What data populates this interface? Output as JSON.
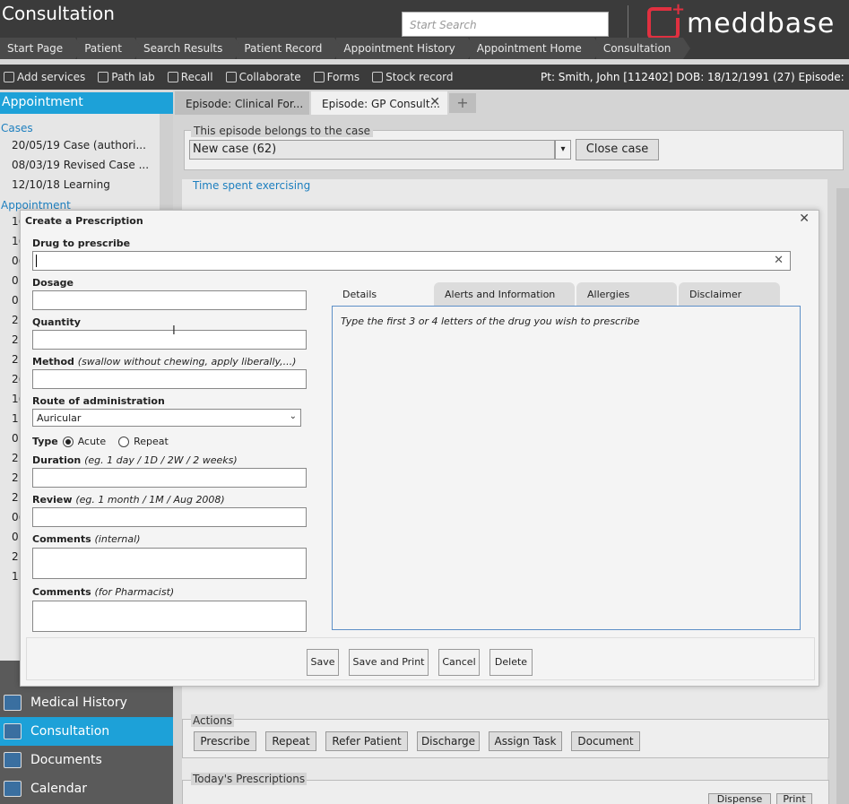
{
  "header": {
    "app_title": "Consultation",
    "search_placeholder": "Start Search",
    "logo_text": "meddbase"
  },
  "breadcrumbs": [
    "Start Page",
    "Patient",
    "Search Results",
    "Patient Record",
    "Appointment History",
    "Appointment Home",
    "Consultation"
  ],
  "toolbar": {
    "items": [
      "Add services",
      "Path lab",
      "Recall",
      "Collaborate",
      "Forms",
      "Stock record"
    ],
    "patient_info": "Pt: Smith, John [112402] DOB: 18/12/1991 (27) Episode:"
  },
  "sidebar": {
    "section_title": "Appointment",
    "cases_label": "Cases",
    "cases": [
      "20/05/19 Case (authori...",
      "08/03/19 Revised Case ...",
      "12/10/18 Learning"
    ],
    "appointments_label": "Appointment",
    "appointments": [
      "1(",
      "1(",
      "0(",
      "0:",
      "0:",
      "2:",
      "2:",
      "2:",
      "2(",
      "1(",
      "1:",
      "0:",
      "2:",
      "2:",
      "2:",
      "0(",
      "0:",
      "2:",
      "1:"
    ],
    "nav": [
      "Medical History",
      "Consultation",
      "Documents",
      "Calendar"
    ]
  },
  "tabs": [
    {
      "label": "Episode: Clinical For..."
    },
    {
      "label": "Episode: GP Consult..."
    }
  ],
  "case": {
    "legend": "This episode belongs to the case",
    "selected": "New case (62)",
    "close_label": "Close case",
    "exercising_label": "Time spent exercising"
  },
  "actions": {
    "legend": "Actions",
    "buttons": [
      "Prescribe",
      "Repeat",
      "Refer Patient",
      "Discharge",
      "Assign Task",
      "Document"
    ]
  },
  "prescriptions": {
    "legend": "Today's Prescriptions",
    "buttons": [
      "Dispense",
      "Print"
    ]
  },
  "modal": {
    "title": "Create a Prescription",
    "drug_label": "Drug to prescribe",
    "drug_value": "",
    "dosage_label": "Dosage",
    "quantity_label": "Quantity",
    "method_label": "Method",
    "method_hint": "(swallow without chewing, apply liberally,...)",
    "route_label": "Route of administration",
    "route_value": "Auricular",
    "type_label": "Type",
    "type_options": [
      "Acute",
      "Repeat"
    ],
    "type_selected": "Acute",
    "duration_label": "Duration",
    "duration_hint": "(eg. 1 day / 1D / 2W / 2 weeks)",
    "review_label": "Review",
    "review_hint": "(eg. 1 month / 1M / Aug 2008)",
    "comments_internal_label": "Comments",
    "comments_internal_hint": "(internal)",
    "comments_pharm_label": "Comments",
    "comments_pharm_hint": "(for Pharmacist)",
    "detail_tabs": [
      "Details",
      "Alerts and Information",
      "Allergies",
      "Disclaimer"
    ],
    "details_hint": "Type the first 3 or 4 letters of the drug you wish to prescribe",
    "buttons": {
      "save": "Save",
      "save_print": "Save and Print",
      "cancel": "Cancel",
      "delete": "Delete"
    }
  }
}
